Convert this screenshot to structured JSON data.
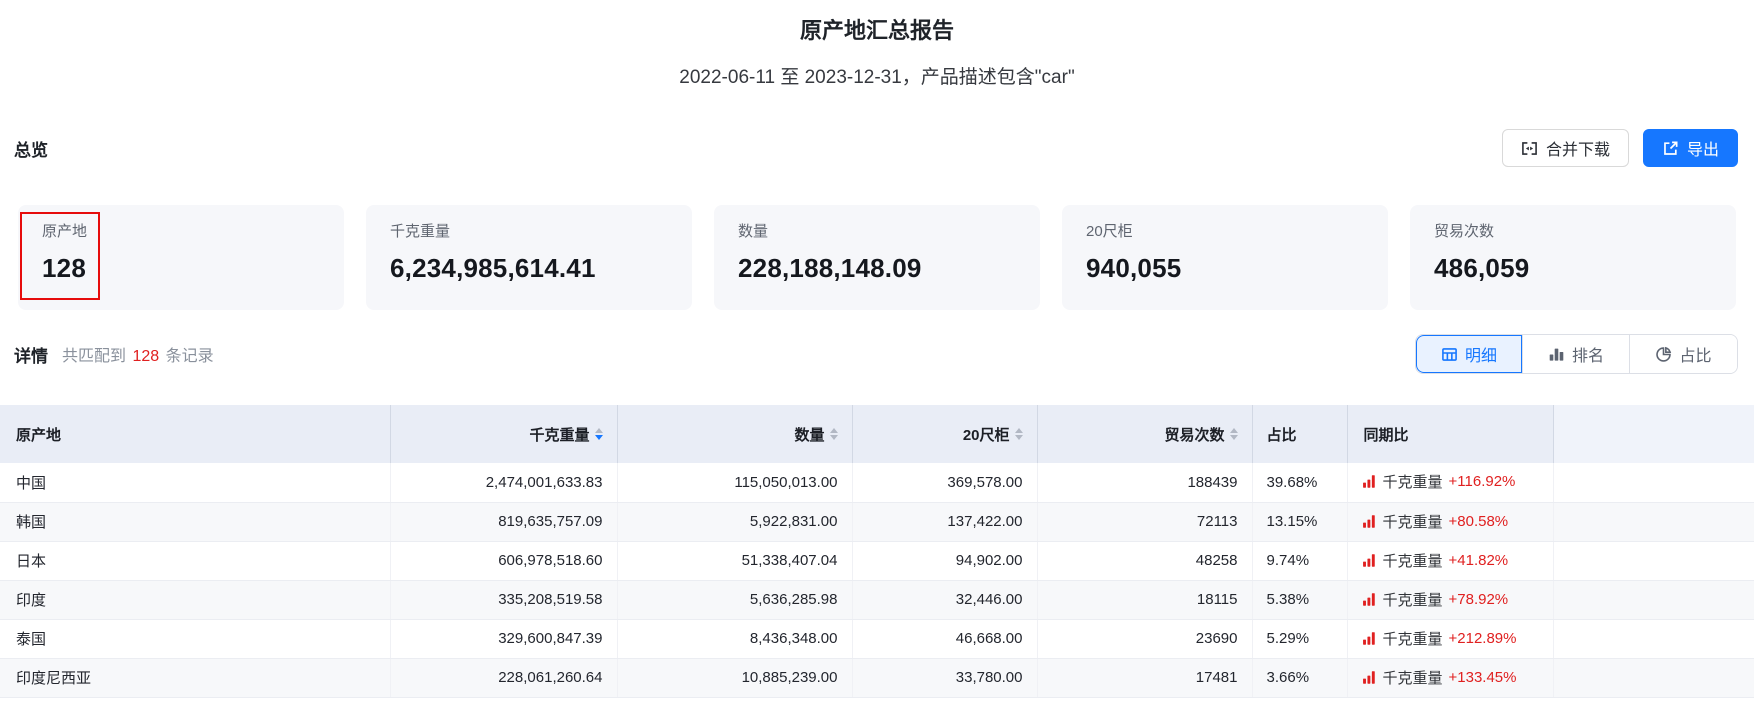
{
  "colors": {
    "accent_blue": "#1677ff",
    "alert_red": "#e02020",
    "header_bg": "#e9edf6"
  },
  "header": {
    "title": "原产地汇总报告",
    "subtitle": "2022-06-11 至 2023-12-31，产品描述包含\"car\""
  },
  "overview": {
    "section_title": "总览",
    "merge_download_label": "合并下载",
    "export_label": "导出",
    "cards": [
      {
        "label": "原产地",
        "value": "128",
        "highlighted": true
      },
      {
        "label": "千克重量",
        "value": "6,234,985,614.41"
      },
      {
        "label": "数量",
        "value": "228,188,148.09"
      },
      {
        "label": "20尺柜",
        "value": "940,055"
      },
      {
        "label": "贸易次数",
        "value": "486,059"
      }
    ]
  },
  "details": {
    "section_title": "详情",
    "match_prefix": "共匹配到",
    "match_count": "128",
    "match_suffix": "条记录",
    "tabs": [
      {
        "label": "明细",
        "icon": "table-icon",
        "active": true
      },
      {
        "label": "排名",
        "icon": "ranking-icon",
        "active": false
      },
      {
        "label": "占比",
        "icon": "pie-icon",
        "active": false
      }
    ]
  },
  "table": {
    "columns": [
      {
        "label": "原产地",
        "align": "left",
        "sortable": false
      },
      {
        "label": "千克重量",
        "align": "right",
        "sortable": true,
        "sort": "desc"
      },
      {
        "label": "数量",
        "align": "right",
        "sortable": true
      },
      {
        "label": "20尺柜",
        "align": "right",
        "sortable": true
      },
      {
        "label": "贸易次数",
        "align": "right",
        "sortable": true
      },
      {
        "label": "占比",
        "align": "left",
        "sortable": false
      },
      {
        "label": "同期比",
        "align": "left",
        "sortable": false
      }
    ],
    "rows": [
      {
        "origin": "中国",
        "weight": "2,474,001,633.83",
        "quantity": "115,050,013.00",
        "teu": "369,578.00",
        "trades": "188439",
        "share": "39.68%",
        "yoy_label": "千克重量",
        "yoy_value": "+116.92%"
      },
      {
        "origin": "韩国",
        "weight": "819,635,757.09",
        "quantity": "5,922,831.00",
        "teu": "137,422.00",
        "trades": "72113",
        "share": "13.15%",
        "yoy_label": "千克重量",
        "yoy_value": "+80.58%"
      },
      {
        "origin": "日本",
        "weight": "606,978,518.60",
        "quantity": "51,338,407.04",
        "teu": "94,902.00",
        "trades": "48258",
        "share": "9.74%",
        "yoy_label": "千克重量",
        "yoy_value": "+41.82%"
      },
      {
        "origin": "印度",
        "weight": "335,208,519.58",
        "quantity": "5,636,285.98",
        "teu": "32,446.00",
        "trades": "18115",
        "share": "5.38%",
        "yoy_label": "千克重量",
        "yoy_value": "+78.92%"
      },
      {
        "origin": "泰国",
        "weight": "329,600,847.39",
        "quantity": "8,436,348.00",
        "teu": "46,668.00",
        "trades": "23690",
        "share": "5.29%",
        "yoy_label": "千克重量",
        "yoy_value": "+212.89%"
      },
      {
        "origin": "印度尼西亚",
        "weight": "228,061,260.64",
        "quantity": "10,885,239.00",
        "teu": "33,780.00",
        "trades": "17481",
        "share": "3.66%",
        "yoy_label": "千克重量",
        "yoy_value": "+133.45%"
      }
    ]
  }
}
